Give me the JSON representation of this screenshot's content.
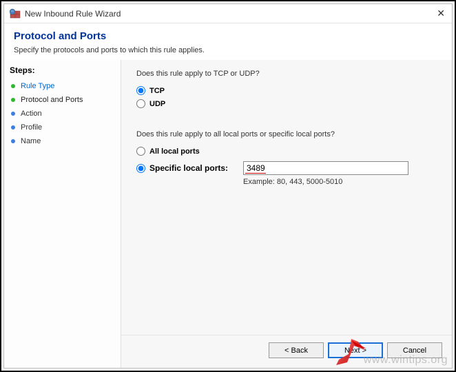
{
  "window": {
    "title": "New Inbound Rule Wizard"
  },
  "header": {
    "title": "Protocol and Ports",
    "subtitle": "Specify the protocols and ports to which this rule applies."
  },
  "sidebar": {
    "title": "Steps:",
    "items": [
      {
        "label": "Rule Type"
      },
      {
        "label": "Protocol and Ports"
      },
      {
        "label": "Action"
      },
      {
        "label": "Profile"
      },
      {
        "label": "Name"
      }
    ]
  },
  "content": {
    "q1": "Does this rule apply to TCP or UDP?",
    "tcp_label": "TCP",
    "udp_label": "UDP",
    "q2": "Does this rule apply to all local ports or specific local ports?",
    "all_ports_label": "All local ports",
    "specific_ports_label": "Specific local ports:",
    "port_value": "3489",
    "example_text": "Example: 80, 443, 5000-5010"
  },
  "footer": {
    "back_label": "< Back",
    "next_label": "Next >",
    "cancel_label": "Cancel"
  },
  "watermark": "www.wintips.org"
}
